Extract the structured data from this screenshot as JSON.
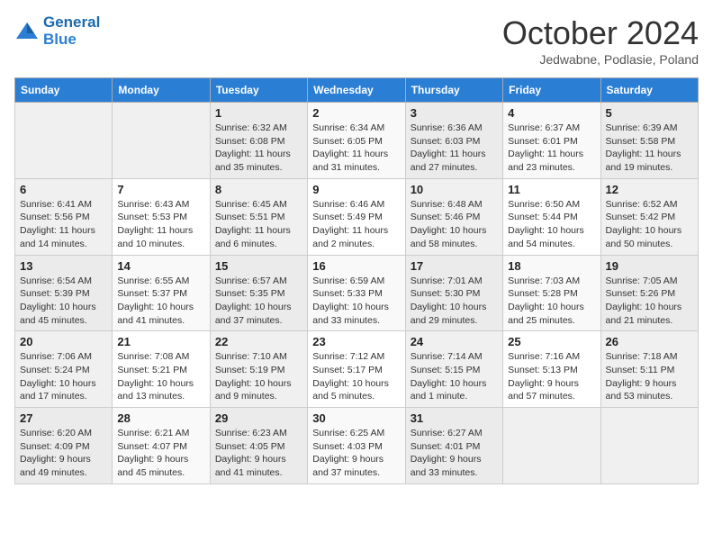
{
  "header": {
    "logo_line1": "General",
    "logo_line2": "Blue",
    "month_title": "October 2024",
    "subtitle": "Jedwabne, Podlasie, Poland"
  },
  "days_of_week": [
    "Sunday",
    "Monday",
    "Tuesday",
    "Wednesday",
    "Thursday",
    "Friday",
    "Saturday"
  ],
  "weeks": [
    [
      {
        "day": "",
        "info": ""
      },
      {
        "day": "",
        "info": ""
      },
      {
        "day": "1",
        "info": "Sunrise: 6:32 AM\nSunset: 6:08 PM\nDaylight: 11 hours and 35 minutes."
      },
      {
        "day": "2",
        "info": "Sunrise: 6:34 AM\nSunset: 6:05 PM\nDaylight: 11 hours and 31 minutes."
      },
      {
        "day": "3",
        "info": "Sunrise: 6:36 AM\nSunset: 6:03 PM\nDaylight: 11 hours and 27 minutes."
      },
      {
        "day": "4",
        "info": "Sunrise: 6:37 AM\nSunset: 6:01 PM\nDaylight: 11 hours and 23 minutes."
      },
      {
        "day": "5",
        "info": "Sunrise: 6:39 AM\nSunset: 5:58 PM\nDaylight: 11 hours and 19 minutes."
      }
    ],
    [
      {
        "day": "6",
        "info": "Sunrise: 6:41 AM\nSunset: 5:56 PM\nDaylight: 11 hours and 14 minutes."
      },
      {
        "day": "7",
        "info": "Sunrise: 6:43 AM\nSunset: 5:53 PM\nDaylight: 11 hours and 10 minutes."
      },
      {
        "day": "8",
        "info": "Sunrise: 6:45 AM\nSunset: 5:51 PM\nDaylight: 11 hours and 6 minutes."
      },
      {
        "day": "9",
        "info": "Sunrise: 6:46 AM\nSunset: 5:49 PM\nDaylight: 11 hours and 2 minutes."
      },
      {
        "day": "10",
        "info": "Sunrise: 6:48 AM\nSunset: 5:46 PM\nDaylight: 10 hours and 58 minutes."
      },
      {
        "day": "11",
        "info": "Sunrise: 6:50 AM\nSunset: 5:44 PM\nDaylight: 10 hours and 54 minutes."
      },
      {
        "day": "12",
        "info": "Sunrise: 6:52 AM\nSunset: 5:42 PM\nDaylight: 10 hours and 50 minutes."
      }
    ],
    [
      {
        "day": "13",
        "info": "Sunrise: 6:54 AM\nSunset: 5:39 PM\nDaylight: 10 hours and 45 minutes."
      },
      {
        "day": "14",
        "info": "Sunrise: 6:55 AM\nSunset: 5:37 PM\nDaylight: 10 hours and 41 minutes."
      },
      {
        "day": "15",
        "info": "Sunrise: 6:57 AM\nSunset: 5:35 PM\nDaylight: 10 hours and 37 minutes."
      },
      {
        "day": "16",
        "info": "Sunrise: 6:59 AM\nSunset: 5:33 PM\nDaylight: 10 hours and 33 minutes."
      },
      {
        "day": "17",
        "info": "Sunrise: 7:01 AM\nSunset: 5:30 PM\nDaylight: 10 hours and 29 minutes."
      },
      {
        "day": "18",
        "info": "Sunrise: 7:03 AM\nSunset: 5:28 PM\nDaylight: 10 hours and 25 minutes."
      },
      {
        "day": "19",
        "info": "Sunrise: 7:05 AM\nSunset: 5:26 PM\nDaylight: 10 hours and 21 minutes."
      }
    ],
    [
      {
        "day": "20",
        "info": "Sunrise: 7:06 AM\nSunset: 5:24 PM\nDaylight: 10 hours and 17 minutes."
      },
      {
        "day": "21",
        "info": "Sunrise: 7:08 AM\nSunset: 5:21 PM\nDaylight: 10 hours and 13 minutes."
      },
      {
        "day": "22",
        "info": "Sunrise: 7:10 AM\nSunset: 5:19 PM\nDaylight: 10 hours and 9 minutes."
      },
      {
        "day": "23",
        "info": "Sunrise: 7:12 AM\nSunset: 5:17 PM\nDaylight: 10 hours and 5 minutes."
      },
      {
        "day": "24",
        "info": "Sunrise: 7:14 AM\nSunset: 5:15 PM\nDaylight: 10 hours and 1 minute."
      },
      {
        "day": "25",
        "info": "Sunrise: 7:16 AM\nSunset: 5:13 PM\nDaylight: 9 hours and 57 minutes."
      },
      {
        "day": "26",
        "info": "Sunrise: 7:18 AM\nSunset: 5:11 PM\nDaylight: 9 hours and 53 minutes."
      }
    ],
    [
      {
        "day": "27",
        "info": "Sunrise: 6:20 AM\nSunset: 4:09 PM\nDaylight: 9 hours and 49 minutes."
      },
      {
        "day": "28",
        "info": "Sunrise: 6:21 AM\nSunset: 4:07 PM\nDaylight: 9 hours and 45 minutes."
      },
      {
        "day": "29",
        "info": "Sunrise: 6:23 AM\nSunset: 4:05 PM\nDaylight: 9 hours and 41 minutes."
      },
      {
        "day": "30",
        "info": "Sunrise: 6:25 AM\nSunset: 4:03 PM\nDaylight: 9 hours and 37 minutes."
      },
      {
        "day": "31",
        "info": "Sunrise: 6:27 AM\nSunset: 4:01 PM\nDaylight: 9 hours and 33 minutes."
      },
      {
        "day": "",
        "info": ""
      },
      {
        "day": "",
        "info": ""
      }
    ]
  ]
}
